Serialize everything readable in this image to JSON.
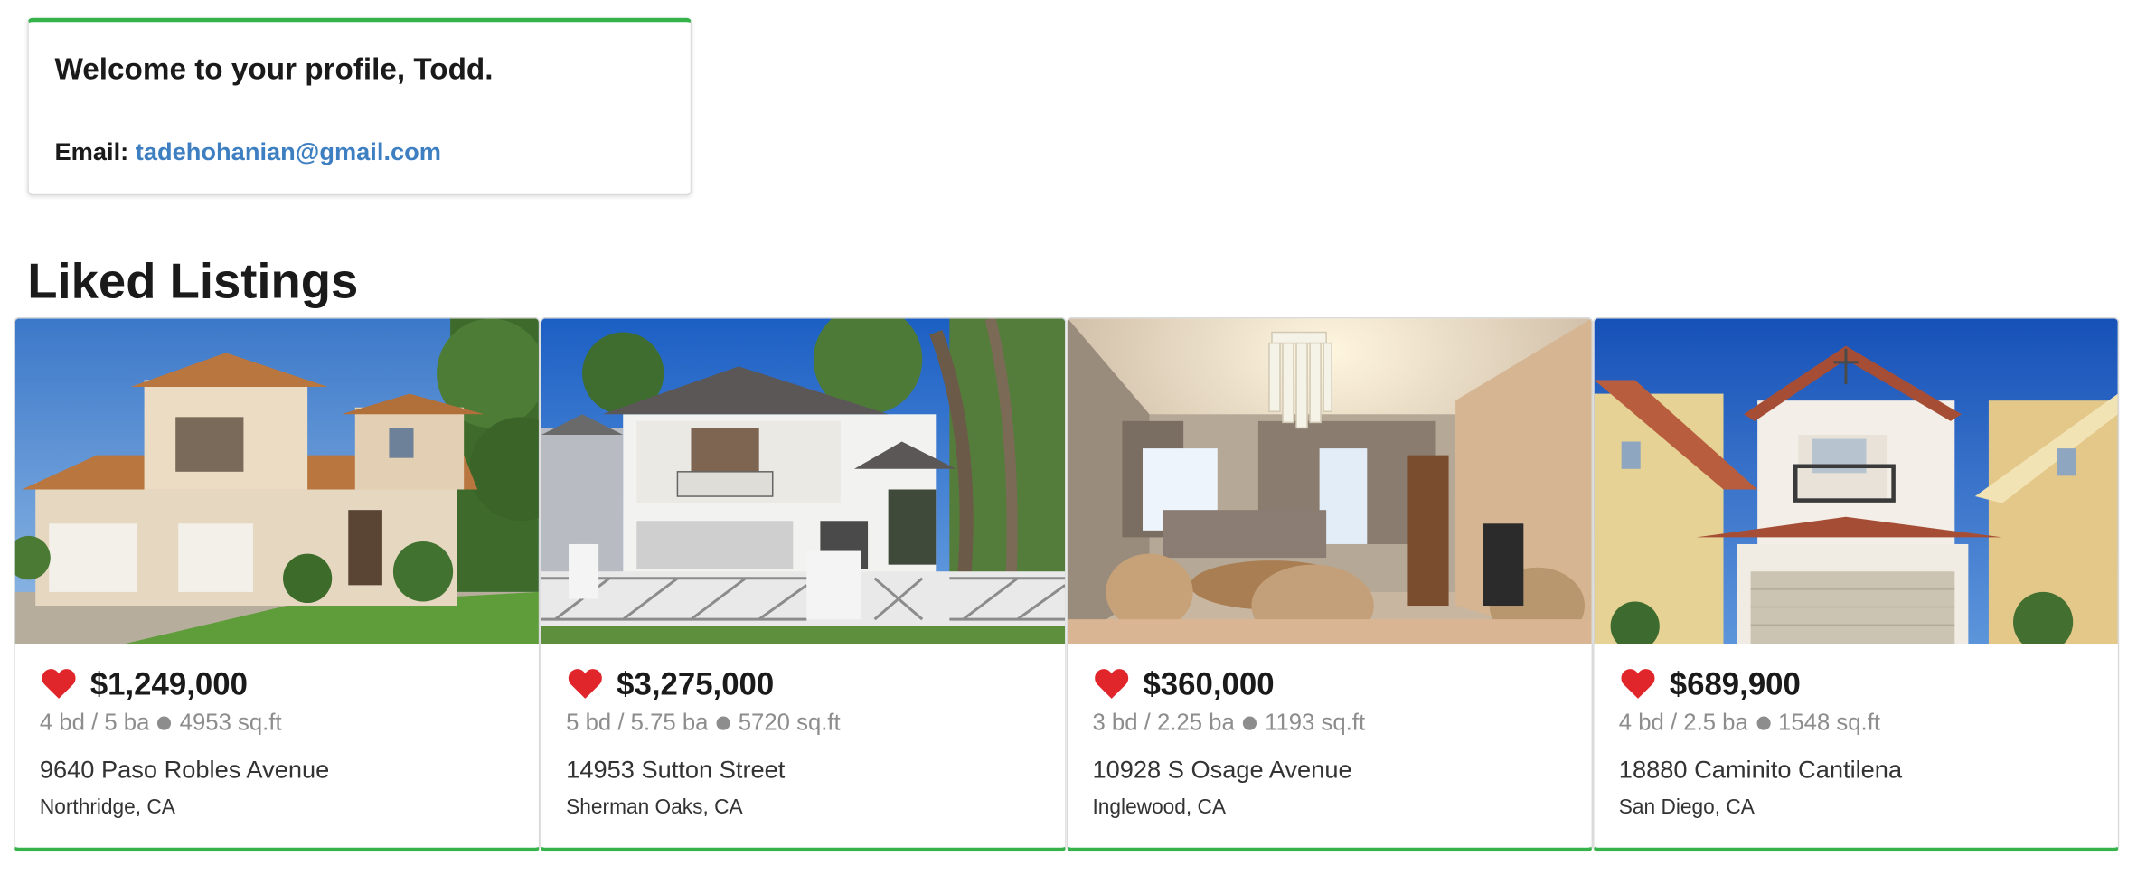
{
  "profile": {
    "welcome": "Welcome to your profile, Todd.",
    "email_label": "Email:",
    "email": "tadehohanian@gmail.com"
  },
  "liked": {
    "title": "Liked Listings",
    "listings": [
      {
        "price": "$1,249,000",
        "beds": "4 bd",
        "baths": "5 ba",
        "sqft": "4953 sq.ft",
        "street": "9640 Paso Robles Avenue",
        "city": "Northridge, CA"
      },
      {
        "price": "$3,275,000",
        "beds": "5 bd",
        "baths": "5.75 ba",
        "sqft": "5720 sq.ft",
        "street": "14953 Sutton Street",
        "city": "Sherman Oaks, CA"
      },
      {
        "price": "$360,000",
        "beds": "3 bd",
        "baths": "2.25 ba",
        "sqft": "1193 sq.ft",
        "street": "10928 S Osage Avenue",
        "city": "Inglewood, CA"
      },
      {
        "price": "$689,900",
        "beds": "4 bd",
        "baths": "2.5 ba",
        "sqft": "1548 sq.ft",
        "street": "18880 Caminito Cantilena",
        "city": "San Diego, CA"
      }
    ]
  },
  "icons": {
    "liked": "heart-icon"
  },
  "colors": {
    "accent_green": "#35b34a",
    "link_blue": "#3d7fc1",
    "heart_red": "#e0262b"
  }
}
